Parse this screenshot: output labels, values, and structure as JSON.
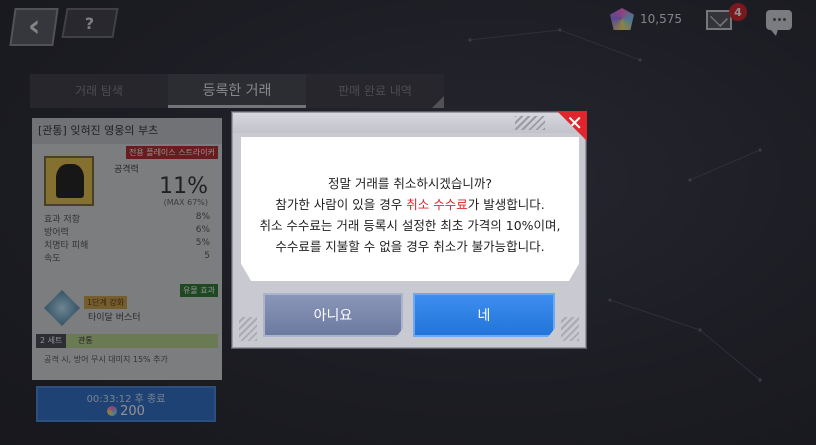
{
  "top_bar": {
    "back_icon": "chevron-left-icon",
    "help_label": "?",
    "currency_value": "10,575",
    "mail_badge": "4"
  },
  "tabs": [
    {
      "label": "거래 탐색"
    },
    {
      "label": "등록한 거래"
    },
    {
      "label": "판매 완료 내역"
    }
  ],
  "item_card": {
    "title": "[관통] 잊혀진 영웅의 부츠",
    "tag_red": "전용 플레이스 스트라이커",
    "stat_label": "공격력",
    "main_value": "11%",
    "max_value": "(MAX 67%)",
    "stats": [
      {
        "name": "효과 저항",
        "value": "8%"
      },
      {
        "name": "방어력",
        "value": "6%"
      },
      {
        "name": "치명타 피해",
        "value": "5%"
      },
      {
        "name": "속도",
        "value": "5"
      }
    ],
    "tag_green": "유물 효과",
    "skill_badge": "1단계 강화",
    "skill_name": "타이달 버스터",
    "set_num": "2 세트",
    "set_label": "관통",
    "set_desc": "공격 시, 방어 무시 대미지 15% 추가"
  },
  "timer": {
    "remaining": "00:33:12 후 종료",
    "price": "200"
  },
  "dialog": {
    "line1": "정말 거래를 취소하시겠습니까?",
    "line2_pre": "참가한 사람이 있을 경우 ",
    "line2_red": "취소 수수료",
    "line2_post": "가 발생합니다.",
    "line3": "취소 수수료는 거래 등록시 설정한 최초 가격의 10%이며,",
    "line4": "수수료를 지불할 수 없을 경우 취소가 불가능합니다.",
    "no_label": "아니요",
    "yes_label": "네"
  }
}
